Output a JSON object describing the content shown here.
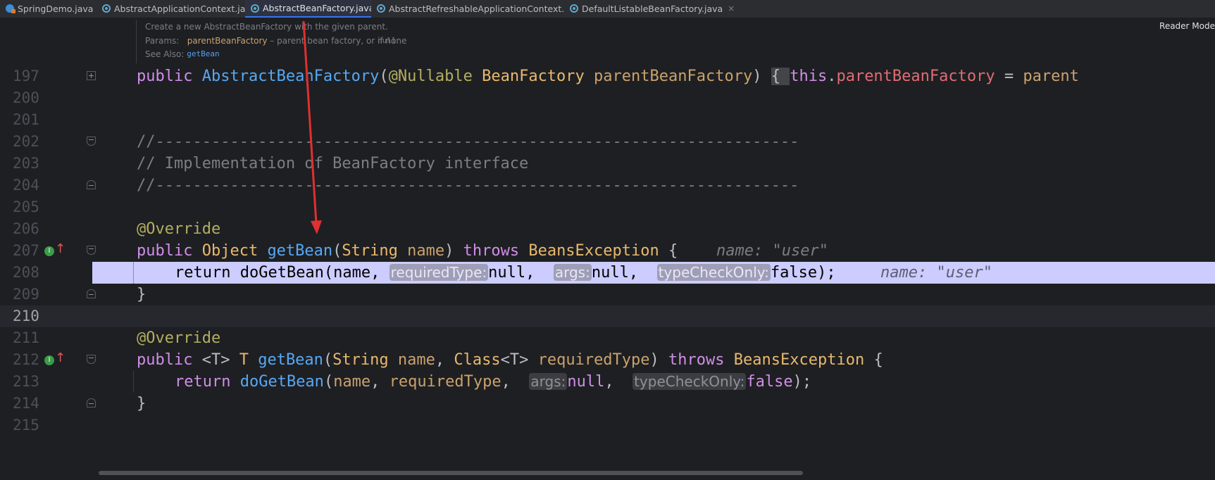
{
  "tabs": [
    {
      "label": "SpringDemo.java",
      "icon": "java-file-icon",
      "active": false
    },
    {
      "label": "AbstractApplicationContext.java",
      "icon": "class-icon",
      "active": false
    },
    {
      "label": "AbstractBeanFactory.java",
      "icon": "class-icon",
      "active": true
    },
    {
      "label": "AbstractRefreshableApplicationContext.java",
      "icon": "class-icon",
      "active": false
    },
    {
      "label": "DefaultListableBeanFactory.java",
      "icon": "class-icon",
      "active": false
    }
  ],
  "tab_close_glyph": "×",
  "doc": {
    "description": "Create a new AbstractBeanFactory with the given parent.",
    "params_label": "Params:",
    "param_name": "parentBeanFactory",
    "param_desc_pre": " – parent bean factory, or ",
    "param_desc_code": "null",
    "param_desc_post": " if none",
    "see_also_label": "See Also:",
    "see_also_link": "getBean"
  },
  "reader_mode": "Reader Mode",
  "lines": {
    "l197": {
      "num": "197",
      "t1": "public ",
      "t2": "AbstractBeanFactory",
      "t3": "(",
      "t4": "@Nullable ",
      "t5": "BeanFactory ",
      "t6": "parentBeanFactory",
      "t7": ") ",
      "t8": "{ ",
      "t9": "this",
      "t10": ".",
      "t11": "parentBeanFactory",
      "t12": " = ",
      "t13": "parent"
    },
    "l200": {
      "num": "200"
    },
    "l201": {
      "num": "201"
    },
    "l202": {
      "num": "202",
      "text": "//---------------------------------------------------------------------"
    },
    "l203": {
      "num": "203",
      "text": "// Implementation of BeanFactory interface"
    },
    "l204": {
      "num": "204",
      "text": "//---------------------------------------------------------------------"
    },
    "l205": {
      "num": "205"
    },
    "l206": {
      "num": "206",
      "text": "@Override"
    },
    "l207": {
      "num": "207",
      "t1": "public ",
      "t2": "Object ",
      "t3": "getBean",
      "t4": "(",
      "t5": "String ",
      "t6": "name",
      "t7": ") ",
      "t8": "throws ",
      "t9": "BeansException ",
      "t10": "{",
      "inlay": "name: \"user\""
    },
    "l208": {
      "num": "208",
      "t1": "return ",
      "t2": "doGetBean(name, ",
      "h1": "requiredType:",
      "t3": "null, ",
      "h2": "args:",
      "t4": "null, ",
      "h3": "typeCheckOnly:",
      "t5": "false);",
      "inlay": "name: \"user\""
    },
    "l209": {
      "num": "209",
      "text": "}"
    },
    "l210": {
      "num": "210"
    },
    "l211": {
      "num": "211",
      "text": "@Override"
    },
    "l212": {
      "num": "212",
      "t1": "public ",
      "t2": "<T> ",
      "t3": "T ",
      "t4": "getBean",
      "t5": "(",
      "t6": "String ",
      "t7": "name",
      "t8": ", ",
      "t9": "Class",
      "t10": "<T> ",
      "t11": "requiredType",
      "t12": ") ",
      "t13": "throws ",
      "t14": "BeansException ",
      "t15": "{"
    },
    "l213": {
      "num": "213",
      "t1": "return ",
      "t2": "doGetBean",
      "t3": "(",
      "t4": "name",
      "t5": ", ",
      "t6": "requiredType",
      "t7": ", ",
      "h1": "args:",
      "t8": "null",
      "t9": ", ",
      "h2": "typeCheckOnly:",
      "t10": "false",
      "t11": ");"
    },
    "l214": {
      "num": "214",
      "text": "}"
    },
    "l215": {
      "num": "215"
    }
  },
  "gutter": {
    "implementation_marker": "I",
    "overrides_marker": "↑"
  },
  "colors": {
    "background": "#1e1f22",
    "keyword": "#cf8ee8",
    "method": "#56a8f5",
    "type": "#e8b96e",
    "annotation": "#b3ae60",
    "comment": "#7a7e85",
    "field": "#e06c75",
    "highlight_line": "#ccccff",
    "annotation_arrow": "#e03030"
  }
}
